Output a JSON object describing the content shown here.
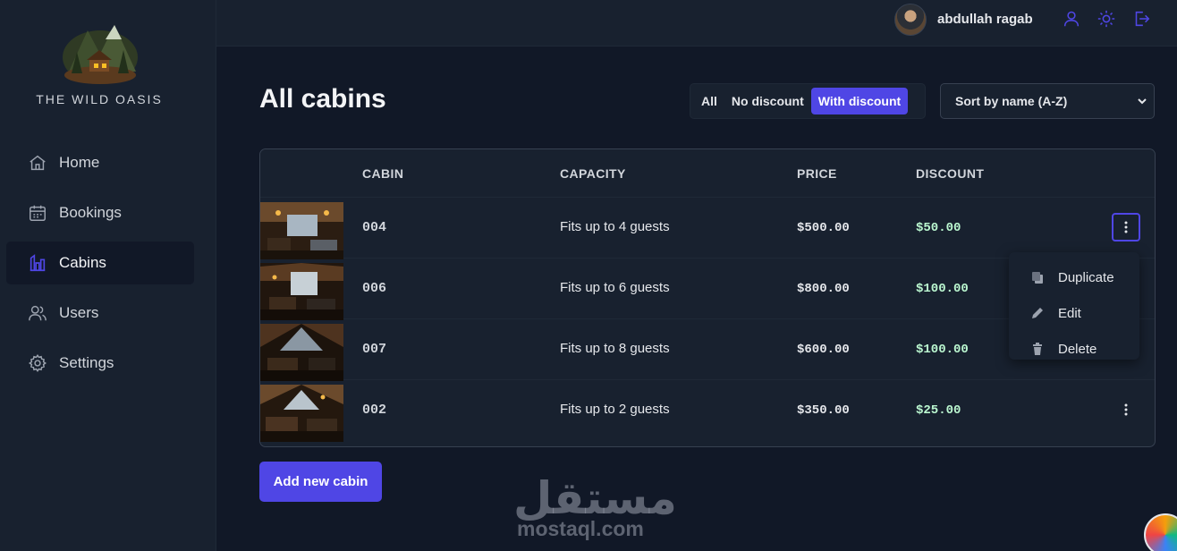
{
  "sidebar": {
    "brand": "THE WILD OASIS",
    "items": [
      {
        "label": "Home",
        "icon": "home-icon"
      },
      {
        "label": "Bookings",
        "icon": "calendar-icon"
      },
      {
        "label": "Cabins",
        "icon": "cabins-icon",
        "active": true
      },
      {
        "label": "Users",
        "icon": "users-icon"
      },
      {
        "label": "Settings",
        "icon": "gear-icon"
      }
    ]
  },
  "header": {
    "username": "abdullah ragab",
    "icons": [
      "user-icon",
      "sun-icon",
      "logout-icon"
    ]
  },
  "main": {
    "title": "All cabins",
    "filters": [
      {
        "label": "All"
      },
      {
        "label": "No discount"
      },
      {
        "label": "With discount",
        "active": true
      }
    ],
    "sort": {
      "selected": "Sort by name (A-Z)"
    },
    "table": {
      "columns": [
        "",
        "CABIN",
        "CAPACITY",
        "PRICE",
        "DISCOUNT"
      ],
      "rows": [
        {
          "cabin": "004",
          "capacity": "Fits up to 4 guests",
          "price": "$500.00",
          "discount": "$50.00"
        },
        {
          "cabin": "006",
          "capacity": "Fits up to 6 guests",
          "price": "$800.00",
          "discount": "$100.00"
        },
        {
          "cabin": "007",
          "capacity": "Fits up to 8 guests",
          "price": "$600.00",
          "discount": "$100.00"
        },
        {
          "cabin": "002",
          "capacity": "Fits up to 2 guests",
          "price": "$350.00",
          "discount": "$25.00"
        }
      ]
    },
    "row_menu": {
      "items": [
        {
          "label": "Duplicate",
          "icon": "copy-icon"
        },
        {
          "label": "Edit",
          "icon": "pencil-icon"
        },
        {
          "label": "Delete",
          "icon": "trash-icon"
        }
      ]
    },
    "add_button": "Add new cabin"
  },
  "watermark": {
    "arabic": "مستقل",
    "latin": "mostaql.com"
  },
  "colors": {
    "accent": "#4f46e5",
    "background": "#111827",
    "panel": "#18212f",
    "discount": "#bbf7d0"
  }
}
